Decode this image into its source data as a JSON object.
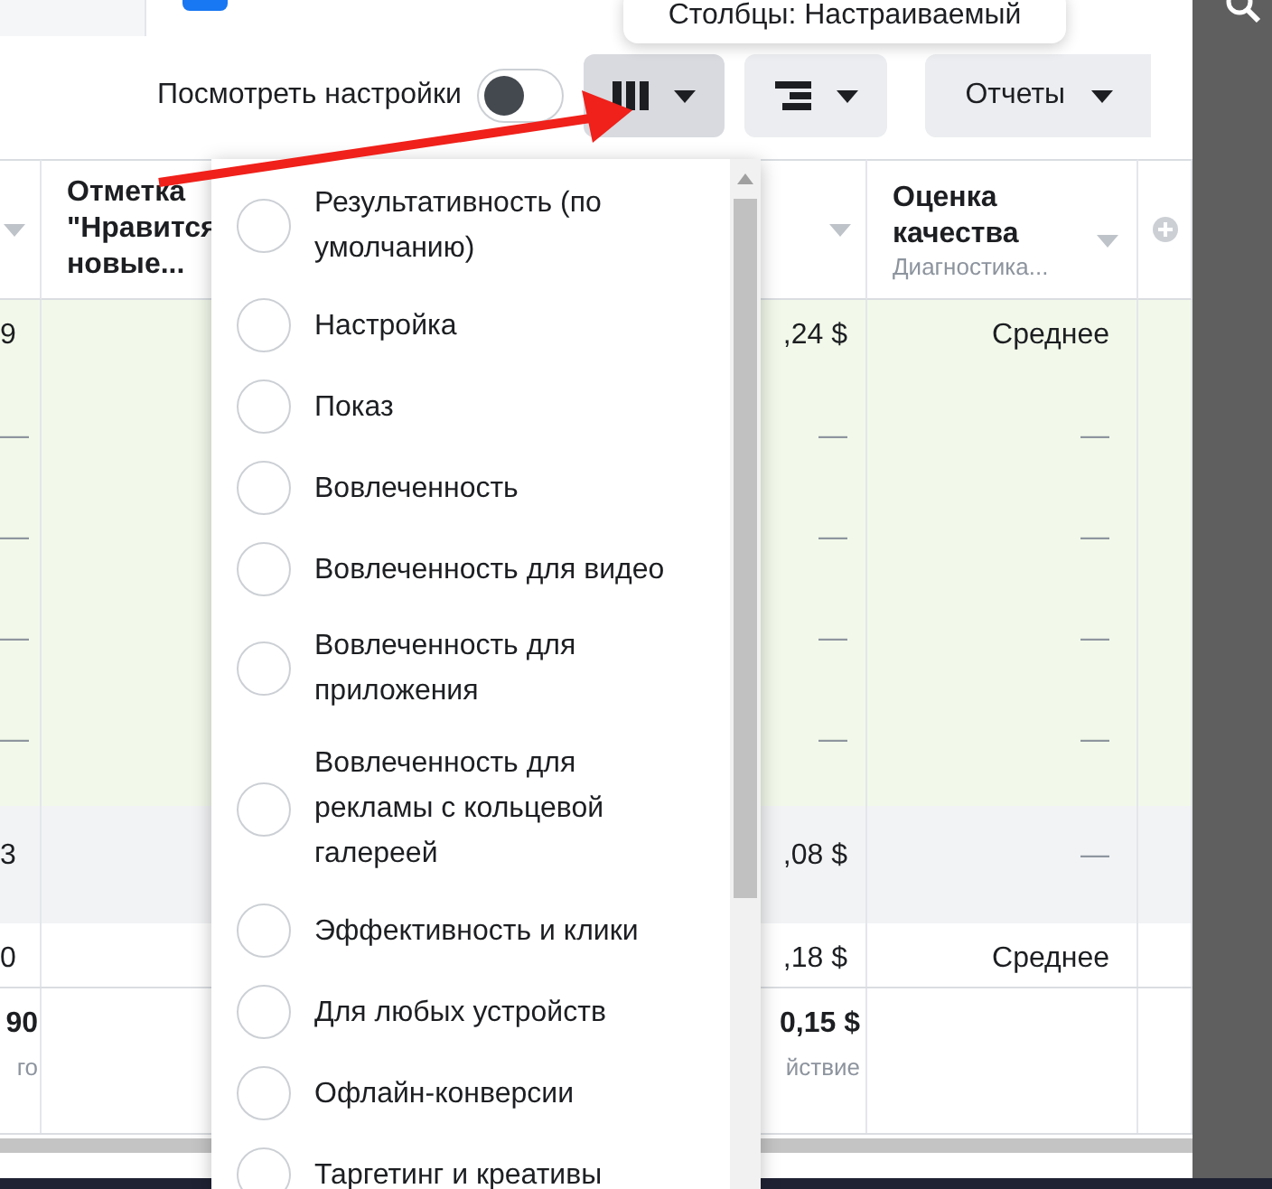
{
  "tooltip": {
    "text": "Столбцы: Настраиваемый"
  },
  "toolbar": {
    "settings_toggle": {
      "label": "Посмотреть настройки",
      "on": false
    },
    "buttons": [
      {
        "kind": "columns",
        "selected": true
      },
      {
        "kind": "breakdown",
        "selected": false
      },
      {
        "kind": "reports",
        "label": "Отчеты",
        "selected": false
      }
    ]
  },
  "table": {
    "columns": [
      {
        "kind": "caret"
      },
      {
        "kind": "title",
        "title": "Отметка \"Нравится новые..."
      },
      {
        "kind": "caret"
      },
      {
        "kind": "title",
        "title": "Оценка качества",
        "subtitle": "Диагностика...",
        "sort_caret": true
      },
      {
        "kind": "add"
      }
    ],
    "rows": [
      {
        "color": "#f2f9ea",
        "cells": [
          "9",
          ",24 $",
          "Среднее"
        ]
      },
      {
        "color": "#f2f9ea",
        "cells": [
          "—",
          "—",
          "—"
        ]
      },
      {
        "color": "#f2f9ea",
        "cells": [
          "—",
          "—",
          "—"
        ]
      },
      {
        "color": "#f2f9ea",
        "cells": [
          "—",
          "—",
          "—"
        ]
      },
      {
        "color": "#f2f9ea",
        "cells": [
          "—",
          "—",
          "—"
        ]
      },
      {
        "color": "#f2f3f5",
        "cells": [
          "3",
          ",08 $",
          "—"
        ]
      },
      {
        "color": "#ffffff",
        "cells": [
          "0",
          ",18 $",
          "Среднее"
        ]
      }
    ],
    "totals": [
      {
        "value": "90",
        "note": "го"
      },
      {
        "value": "0,15 $",
        "note": "йствие"
      }
    ]
  },
  "columns_menu": {
    "items": [
      {
        "label": "Результативность (по умолчанию)",
        "selected": false
      },
      {
        "label": "Настройка",
        "selected": false
      },
      {
        "label": "Показ",
        "selected": false
      },
      {
        "label": "Вовлеченность",
        "selected": false
      },
      {
        "label": "Вовлеченность для видео",
        "selected": false
      },
      {
        "label": "Вовлеченность для приложения",
        "selected": false
      },
      {
        "label": "Вовлеченность для рекламы с кольцевой галереей",
        "selected": false
      },
      {
        "label": "Эффективность и клики",
        "selected": false
      },
      {
        "label": "Для любых устройств",
        "selected": false
      },
      {
        "label": "Офлайн-конверсии",
        "selected": false
      },
      {
        "label": "Таргетинг и креативы",
        "selected": false
      }
    ]
  }
}
